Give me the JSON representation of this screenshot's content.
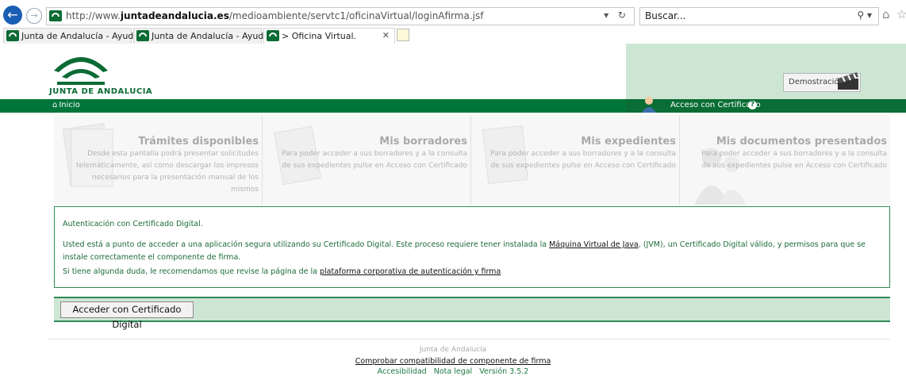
{
  "browser": {
    "url_prefix": "http://www.",
    "url_domain": "juntadeandalucia.es",
    "url_path": "/medioambiente/servtc1/oficinaVirtual/loginAfirma.jsf",
    "url_tools": "▾ ↻",
    "search_placeholder": "Buscar...",
    "tabs": [
      {
        "label": "Junta de Andalucía - Ayudas e..."
      },
      {
        "label": "Junta de Andalucía - Ayudas e..."
      },
      {
        "label": "> Oficina Virtual.",
        "close": "✕"
      }
    ]
  },
  "header": {
    "logo_text": "JUNTA DE ANDALUCIA",
    "demo_label": "Demostración"
  },
  "navbar": {
    "home_label": "Inicio",
    "cert_label": "Acceso con Certificado",
    "help": "?"
  },
  "cards": [
    {
      "title": "Trámites disponibles",
      "desc": "Desde esta pantalla podrá presentar solicitudes telemáticamente, así como descargar los impresos necesarios para la presentación manual de los mismos"
    },
    {
      "title": "Mis borradores",
      "desc": "Para poder acceder a sus borradores y a la consulta de sus expedientes pulse en Acceso con Certificado"
    },
    {
      "title": "Mis expedientes",
      "desc": "Para poder acceder a sus borradores y a la consulta de sus expedientes pulse en Acceso con Certificado"
    },
    {
      "title": "Mis documentos presentados",
      "desc": "Para poder acceder a sus borradores y a la consulta de sus expedientes pulse en Acceso con Certificado"
    }
  ],
  "auth": {
    "title": "Autenticación con Certificado Digital.",
    "p1_before": "Usted está a punto de acceder a una aplicación segura utilizando su Certificado Digital. Este proceso requiere tener instalada la ",
    "p1_link": "Máquina Virtual de Java",
    "p1_after": ", (JVM), un Certificado Digital válido, y permisos para que se instale correctamente el componente de firma.",
    "p2_before": "Si tiene algunda duda, le recomendamos que revise la página de la ",
    "p2_link": "plataforma corporativa de autenticación y firma"
  },
  "action": {
    "button_label": "Acceder con Certificado Digital"
  },
  "footer": {
    "org": "Junta de Andalucía",
    "check_link": "Comprobar compatibilidad de componente de firma",
    "accessibility": "Accesibilidad",
    "legal": "Nota legal",
    "version": "Versión 3.5.2"
  },
  "colors": {
    "brand_green": "#00753a",
    "light_green": "#cde6d4"
  }
}
